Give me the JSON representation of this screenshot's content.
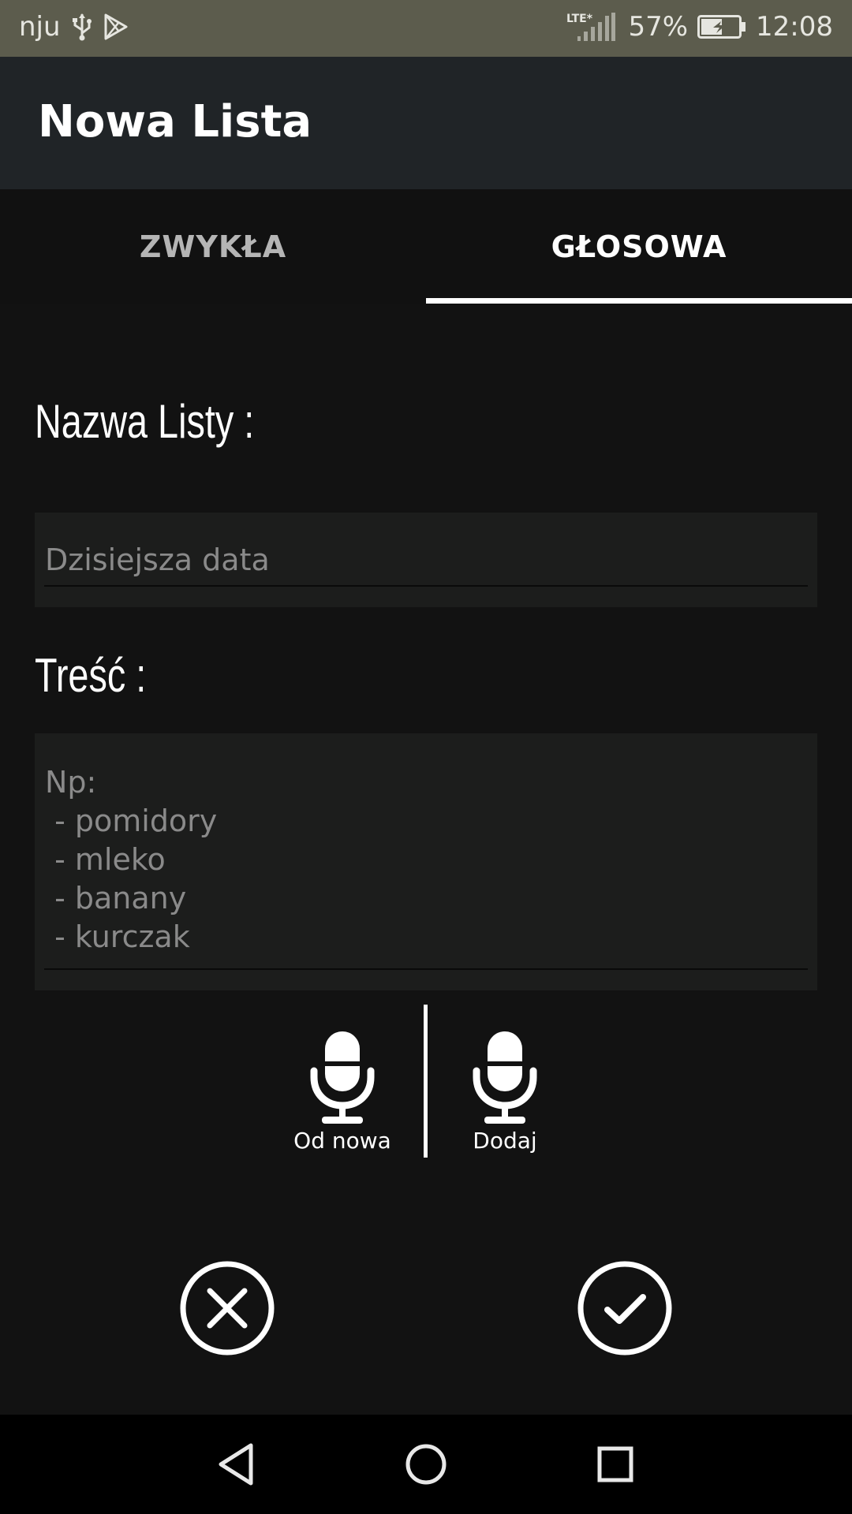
{
  "status_bar": {
    "carrier": "nju",
    "network_label": "LTE*",
    "battery": "57%",
    "time": "12:08"
  },
  "app_bar": {
    "title": "Nowa Lista"
  },
  "tabs": [
    {
      "label": "ZWYKŁA",
      "selected": false
    },
    {
      "label": "GŁOSOWA",
      "selected": true
    }
  ],
  "form": {
    "name_label": "Nazwa Listy :",
    "name_placeholder": "Dzisiejsza data",
    "content_label": "Treść :",
    "content_placeholder": "Np:\n - pomidory\n - mleko\n - banany\n - kurczak"
  },
  "voice_controls": {
    "restart_label": "Od nowa",
    "add_label": "Dodaj",
    "icon": "microphone-icon"
  },
  "actions": {
    "cancel_icon": "close-circle-icon",
    "confirm_icon": "check-circle-icon"
  },
  "nav_bar": {
    "icons": [
      "back-triangle-icon",
      "home-circle-icon",
      "recents-square-icon"
    ]
  },
  "colors": {
    "status_bar": "#5c5c4d",
    "app_bar": "#202427",
    "background": "#121212",
    "field": "#1c1d1c",
    "placeholder": "#8a8a8a"
  }
}
